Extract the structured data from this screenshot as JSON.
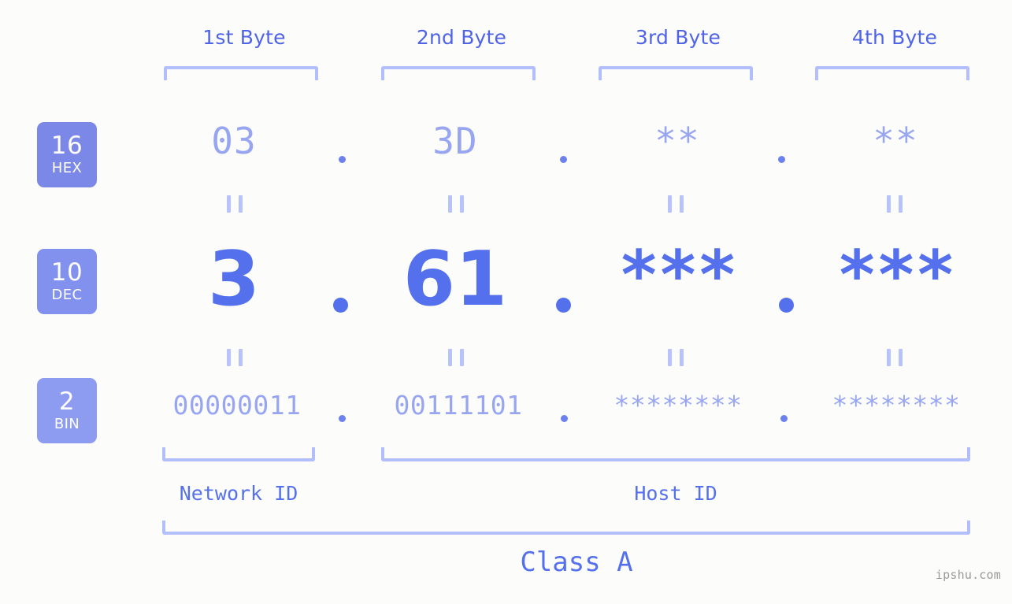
{
  "headers": [
    {
      "label": "1st Byte"
    },
    {
      "label": "2nd Byte"
    },
    {
      "label": "3rd Byte"
    },
    {
      "label": "4th Byte"
    }
  ],
  "bases": [
    {
      "num": "16",
      "name": "HEX",
      "color": "#7b88e8"
    },
    {
      "num": "10",
      "name": "DEC",
      "color": "#8291ee"
    },
    {
      "num": "2",
      "name": "BIN",
      "color": "#8d9bf0"
    }
  ],
  "rows": {
    "hex": {
      "base": "16",
      "name": "HEX",
      "octets": [
        "03",
        "3D",
        "**",
        "**"
      ]
    },
    "dec": {
      "base": "10",
      "name": "DEC",
      "octets": [
        "3",
        "61",
        "***",
        "***"
      ]
    },
    "bin": {
      "base": "2",
      "name": "BIN",
      "octets": [
        "00000011",
        "00111101",
        "********",
        "********"
      ]
    }
  },
  "separators": {
    "dot": "."
  },
  "sections": [
    {
      "label": "Network ID"
    },
    {
      "label": "Host ID"
    }
  ],
  "class": {
    "label": "Class A"
  },
  "watermark": {
    "text": "ipshu.com"
  },
  "colors": {
    "background": "#fcfdfa",
    "accent": "#5570ec",
    "accent_light": "#98a6f2",
    "bracket": "#b3befc",
    "badge_hex": "#7b88e8",
    "badge_dec": "#8291ee",
    "badge_bin": "#8d9bf0",
    "watermark": "#9a9a9a"
  }
}
